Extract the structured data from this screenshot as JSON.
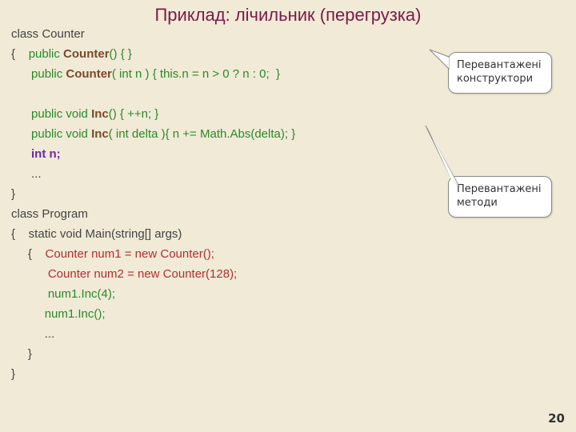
{
  "title": "Приклад: лічильник (перегрузка)",
  "pagenum": "20",
  "callout1": {
    "l1": "Перевантажені",
    "l2": "конструктори"
  },
  "callout2": {
    "l1": "Перевантажені",
    "l2": "методи"
  },
  "code": {
    "l1": "class Counter",
    "l2a": "{    ",
    "l2b": "public ",
    "l2c": "Counter",
    "l2d": "() { }",
    "l3a": "      ",
    "l3b": "public ",
    "l3c": "Counter",
    "l3d": "( int n ) { this.n = n > 0 ? n : 0;  }",
    "sp1": " ",
    "l4a": "      ",
    "l4b": "public void ",
    "l4c": "Inc",
    "l4d": "() { ++n; }",
    "l5a": "      ",
    "l5b": "public void ",
    "l5c": "Inc",
    "l5d": "( int delta ){ n += Math.Abs(delta); }",
    "l6a": "      ",
    "l6b": "int n;",
    "l7a": "      ",
    "l7b": "...",
    "l8": "}",
    "l9": "class Program",
    "l10": "{    static void Main(string[] args)",
    "l11a": "     {    ",
    "l11b": "Counter num1 = new Counter();",
    "l12a": "           ",
    "l12b": "Counter num2 = new Counter(128);",
    "l13a": "           ",
    "l13b": "num1.Inc(4);",
    "l14a": "          ",
    "l14b": "num1.Inc();",
    "l15": "          ...",
    "l16": "     }",
    "l17": "}"
  }
}
